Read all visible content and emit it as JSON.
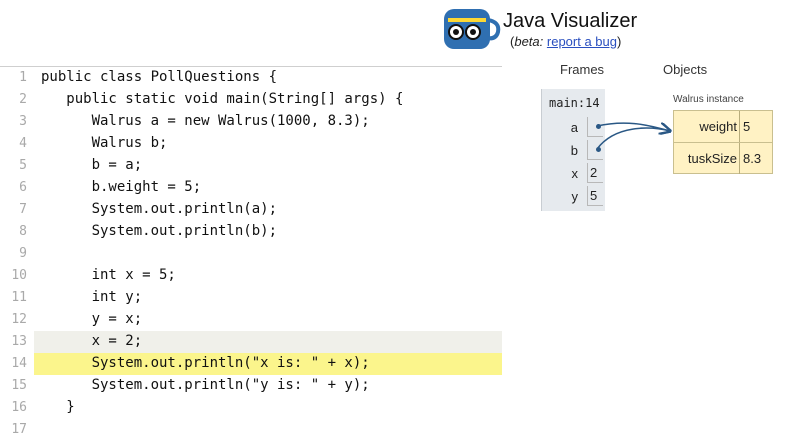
{
  "header": {
    "title": "Java Visualizer",
    "beta_label": "beta:",
    "report_link": "report a bug",
    "open_paren": "(",
    "close_paren": ")"
  },
  "code": {
    "lines": [
      {
        "num": "1",
        "text": "public class PollQuestions {"
      },
      {
        "num": "2",
        "text": "   public static void main(String[] args) {"
      },
      {
        "num": "3",
        "text": "      Walrus a = new Walrus(1000, 8.3);"
      },
      {
        "num": "4",
        "text": "      Walrus b;"
      },
      {
        "num": "5",
        "text": "      b = a;"
      },
      {
        "num": "6",
        "text": "      b.weight = 5;"
      },
      {
        "num": "7",
        "text": "      System.out.println(a);"
      },
      {
        "num": "8",
        "text": "      System.out.println(b);"
      },
      {
        "num": "9",
        "text": ""
      },
      {
        "num": "10",
        "text": "      int x = 5;"
      },
      {
        "num": "11",
        "text": "      int y;"
      },
      {
        "num": "12",
        "text": "      y = x;"
      },
      {
        "num": "13",
        "text": "      x = 2;"
      },
      {
        "num": "14",
        "text": "      System.out.println(\"x is: \" + x);"
      },
      {
        "num": "15",
        "text": "      System.out.println(\"y is: \" + y);"
      },
      {
        "num": "16",
        "text": "   }"
      },
      {
        "num": "17",
        "text": ""
      }
    ],
    "previous_line": 13,
    "current_line": 14
  },
  "viz": {
    "frames_header": "Frames",
    "objects_header": "Objects",
    "frame": {
      "name": "main:14",
      "vars": [
        {
          "name": "a",
          "value": ""
        },
        {
          "name": "b",
          "value": ""
        },
        {
          "name": "x",
          "value": "2"
        },
        {
          "name": "y",
          "value": "5"
        }
      ]
    },
    "object": {
      "label": "Walrus instance",
      "fields": [
        {
          "name": "weight",
          "value": "5"
        },
        {
          "name": "tuskSize",
          "value": "8.3"
        }
      ]
    }
  },
  "colors": {
    "current_line_highlight": "#fbf58c",
    "object_bg": "#fff2c4",
    "frame_bg": "#e6eaee",
    "pointer": "#2a5885",
    "link": "#2a4fbf"
  }
}
